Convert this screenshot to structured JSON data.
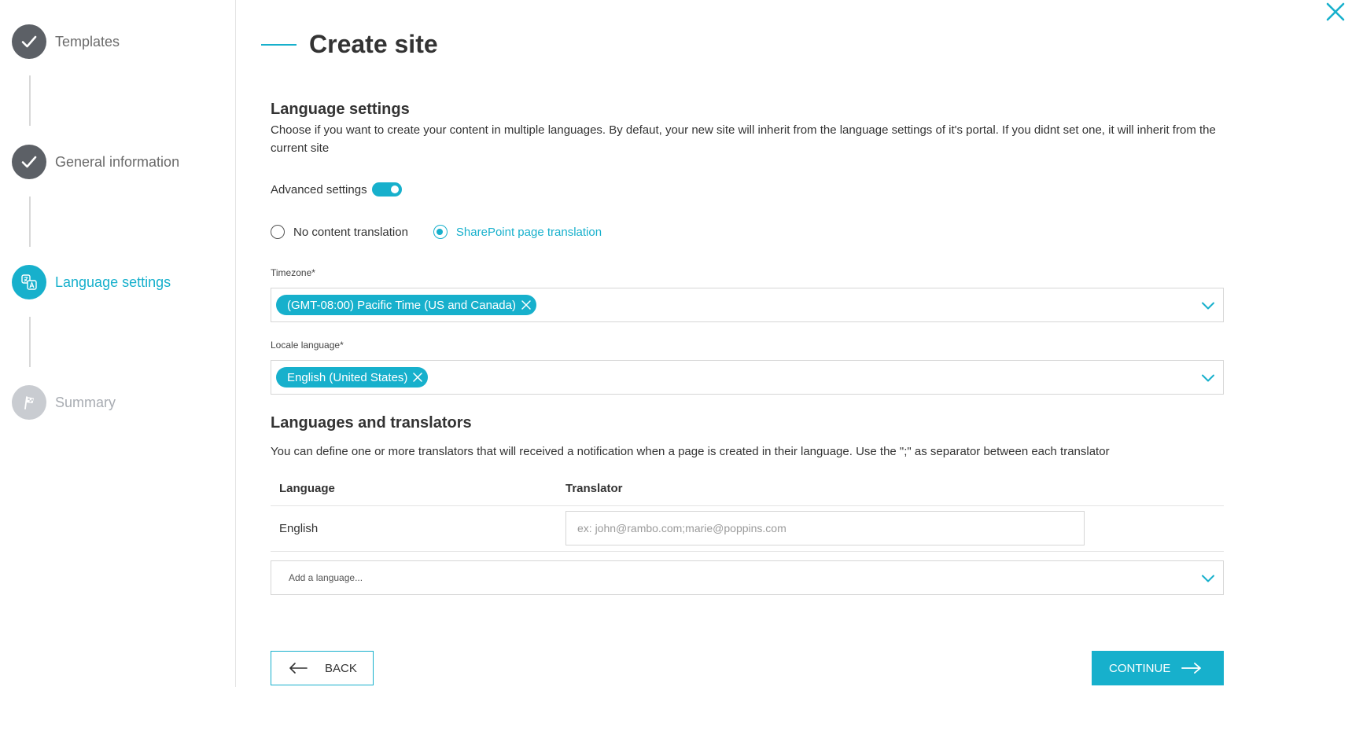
{
  "sidebar": {
    "steps": [
      {
        "label": "Templates",
        "state": "done",
        "icon": "check-icon"
      },
      {
        "label": "General information",
        "state": "done",
        "icon": "check-icon"
      },
      {
        "label": "Language settings",
        "state": "active",
        "icon": "translate-icon"
      },
      {
        "label": "Summary",
        "state": "pending",
        "icon": "flag-icon"
      }
    ]
  },
  "header": {
    "title": "Create site"
  },
  "language_settings": {
    "title": "Language settings",
    "description": "Choose if you want to create your content in multiple languages. By defaut, your new site will inherit from the language settings of it's portal. If you didnt set one, it will inherit from the current site",
    "advanced_label": "Advanced settings",
    "advanced_enabled": true,
    "radios": [
      {
        "label": "No content translation",
        "selected": false
      },
      {
        "label": "SharePoint page translation",
        "selected": true
      }
    ],
    "timezone": {
      "label": "Timezone*",
      "value": "(GMT-08:00) Pacific Time (US and Canada)"
    },
    "locale": {
      "label": "Locale language*",
      "value": "English (United States)"
    }
  },
  "translators": {
    "title": "Languages and translators",
    "description": "You can define one or more translators that will received a notification when a page is created in their language. Use the \";\" as separator between each translator",
    "columns": [
      "Language",
      "Translator"
    ],
    "rows": [
      {
        "language": "English",
        "translator": "",
        "placeholder": "ex: john@rambo.com;marie@poppins.com"
      }
    ],
    "add_language_placeholder": "Add a language..."
  },
  "actions": {
    "back_label": "BACK",
    "continue_label": "CONTINUE"
  },
  "colors": {
    "accent": "#17b0cc",
    "step_done": "#5c6066",
    "step_pending": "#c9ccd1"
  }
}
